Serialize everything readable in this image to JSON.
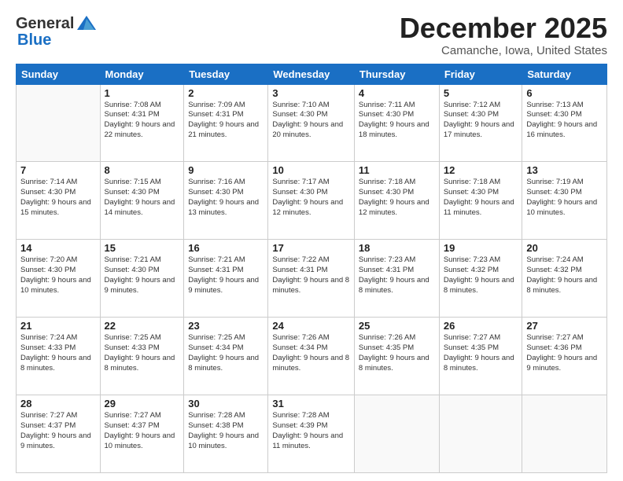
{
  "logo": {
    "general": "General",
    "blue": "Blue"
  },
  "title": "December 2025",
  "location": "Camanche, Iowa, United States",
  "days_of_week": [
    "Sunday",
    "Monday",
    "Tuesday",
    "Wednesday",
    "Thursday",
    "Friday",
    "Saturday"
  ],
  "weeks": [
    [
      {
        "day": null,
        "info": null
      },
      {
        "day": "1",
        "info": "Sunrise: 7:08 AM\nSunset: 4:31 PM\nDaylight: 9 hours and 22 minutes."
      },
      {
        "day": "2",
        "info": "Sunrise: 7:09 AM\nSunset: 4:31 PM\nDaylight: 9 hours and 21 minutes."
      },
      {
        "day": "3",
        "info": "Sunrise: 7:10 AM\nSunset: 4:30 PM\nDaylight: 9 hours and 20 minutes."
      },
      {
        "day": "4",
        "info": "Sunrise: 7:11 AM\nSunset: 4:30 PM\nDaylight: 9 hours and 18 minutes."
      },
      {
        "day": "5",
        "info": "Sunrise: 7:12 AM\nSunset: 4:30 PM\nDaylight: 9 hours and 17 minutes."
      },
      {
        "day": "6",
        "info": "Sunrise: 7:13 AM\nSunset: 4:30 PM\nDaylight: 9 hours and 16 minutes."
      }
    ],
    [
      {
        "day": "7",
        "info": "Sunrise: 7:14 AM\nSunset: 4:30 PM\nDaylight: 9 hours and 15 minutes."
      },
      {
        "day": "8",
        "info": "Sunrise: 7:15 AM\nSunset: 4:30 PM\nDaylight: 9 hours and 14 minutes."
      },
      {
        "day": "9",
        "info": "Sunrise: 7:16 AM\nSunset: 4:30 PM\nDaylight: 9 hours and 13 minutes."
      },
      {
        "day": "10",
        "info": "Sunrise: 7:17 AM\nSunset: 4:30 PM\nDaylight: 9 hours and 12 minutes."
      },
      {
        "day": "11",
        "info": "Sunrise: 7:18 AM\nSunset: 4:30 PM\nDaylight: 9 hours and 12 minutes."
      },
      {
        "day": "12",
        "info": "Sunrise: 7:18 AM\nSunset: 4:30 PM\nDaylight: 9 hours and 11 minutes."
      },
      {
        "day": "13",
        "info": "Sunrise: 7:19 AM\nSunset: 4:30 PM\nDaylight: 9 hours and 10 minutes."
      }
    ],
    [
      {
        "day": "14",
        "info": "Sunrise: 7:20 AM\nSunset: 4:30 PM\nDaylight: 9 hours and 10 minutes."
      },
      {
        "day": "15",
        "info": "Sunrise: 7:21 AM\nSunset: 4:30 PM\nDaylight: 9 hours and 9 minutes."
      },
      {
        "day": "16",
        "info": "Sunrise: 7:21 AM\nSunset: 4:31 PM\nDaylight: 9 hours and 9 minutes."
      },
      {
        "day": "17",
        "info": "Sunrise: 7:22 AM\nSunset: 4:31 PM\nDaylight: 9 hours and 8 minutes."
      },
      {
        "day": "18",
        "info": "Sunrise: 7:23 AM\nSunset: 4:31 PM\nDaylight: 9 hours and 8 minutes."
      },
      {
        "day": "19",
        "info": "Sunrise: 7:23 AM\nSunset: 4:32 PM\nDaylight: 9 hours and 8 minutes."
      },
      {
        "day": "20",
        "info": "Sunrise: 7:24 AM\nSunset: 4:32 PM\nDaylight: 9 hours and 8 minutes."
      }
    ],
    [
      {
        "day": "21",
        "info": "Sunrise: 7:24 AM\nSunset: 4:33 PM\nDaylight: 9 hours and 8 minutes."
      },
      {
        "day": "22",
        "info": "Sunrise: 7:25 AM\nSunset: 4:33 PM\nDaylight: 9 hours and 8 minutes."
      },
      {
        "day": "23",
        "info": "Sunrise: 7:25 AM\nSunset: 4:34 PM\nDaylight: 9 hours and 8 minutes."
      },
      {
        "day": "24",
        "info": "Sunrise: 7:26 AM\nSunset: 4:34 PM\nDaylight: 9 hours and 8 minutes."
      },
      {
        "day": "25",
        "info": "Sunrise: 7:26 AM\nSunset: 4:35 PM\nDaylight: 9 hours and 8 minutes."
      },
      {
        "day": "26",
        "info": "Sunrise: 7:27 AM\nSunset: 4:35 PM\nDaylight: 9 hours and 8 minutes."
      },
      {
        "day": "27",
        "info": "Sunrise: 7:27 AM\nSunset: 4:36 PM\nDaylight: 9 hours and 9 minutes."
      }
    ],
    [
      {
        "day": "28",
        "info": "Sunrise: 7:27 AM\nSunset: 4:37 PM\nDaylight: 9 hours and 9 minutes."
      },
      {
        "day": "29",
        "info": "Sunrise: 7:27 AM\nSunset: 4:37 PM\nDaylight: 9 hours and 10 minutes."
      },
      {
        "day": "30",
        "info": "Sunrise: 7:28 AM\nSunset: 4:38 PM\nDaylight: 9 hours and 10 minutes."
      },
      {
        "day": "31",
        "info": "Sunrise: 7:28 AM\nSunset: 4:39 PM\nDaylight: 9 hours and 11 minutes."
      },
      {
        "day": null,
        "info": null
      },
      {
        "day": null,
        "info": null
      },
      {
        "day": null,
        "info": null
      }
    ]
  ]
}
